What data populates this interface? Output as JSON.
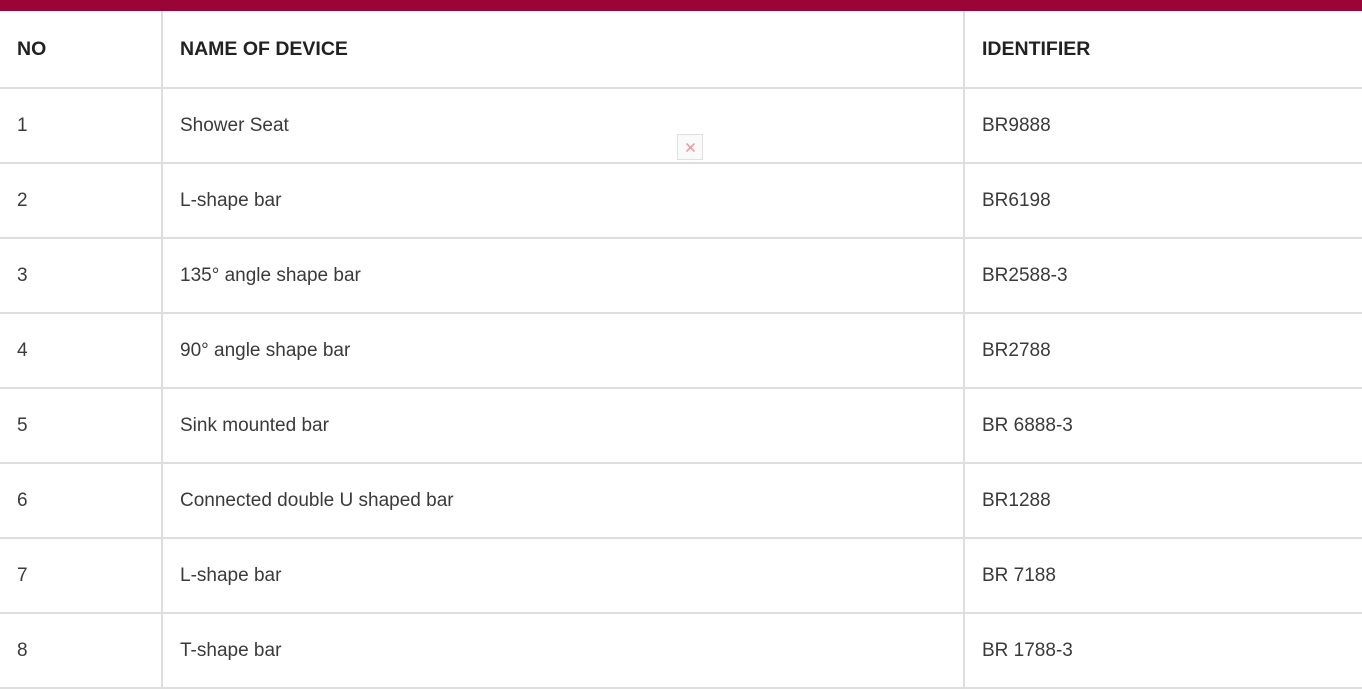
{
  "header": {
    "no": "NO",
    "name": "NAME OF DEVICE",
    "identifier": "IDENTIFIER"
  },
  "rows": [
    {
      "no": "1",
      "name": "Shower Seat",
      "identifier": "BR9888"
    },
    {
      "no": "2",
      "name": "L-shape bar",
      "identifier": "BR6198"
    },
    {
      "no": "3",
      "name": "135° angle shape bar",
      "identifier": "BR2588-3"
    },
    {
      "no": "4",
      "name": "90° angle shape bar",
      "identifier": "BR2788"
    },
    {
      "no": "5",
      "name": "Sink mounted bar",
      "identifier": "BR 6888-3"
    },
    {
      "no": "6",
      "name": "Connected double U shaped bar",
      "identifier": "BR1288"
    },
    {
      "no": "7",
      "name": "L-shape bar",
      "identifier": "BR 7188"
    },
    {
      "no": "8",
      "name": "T-shape bar",
      "identifier": "BR 1788-3"
    }
  ],
  "colors": {
    "accent_bar": "#9b0436",
    "grid_border": "#dedede",
    "text": "#3a3a3a",
    "header_text": "#222222",
    "broken_icon": "#e8a0a0"
  },
  "icons": {
    "broken_image": "broken-image-icon"
  }
}
